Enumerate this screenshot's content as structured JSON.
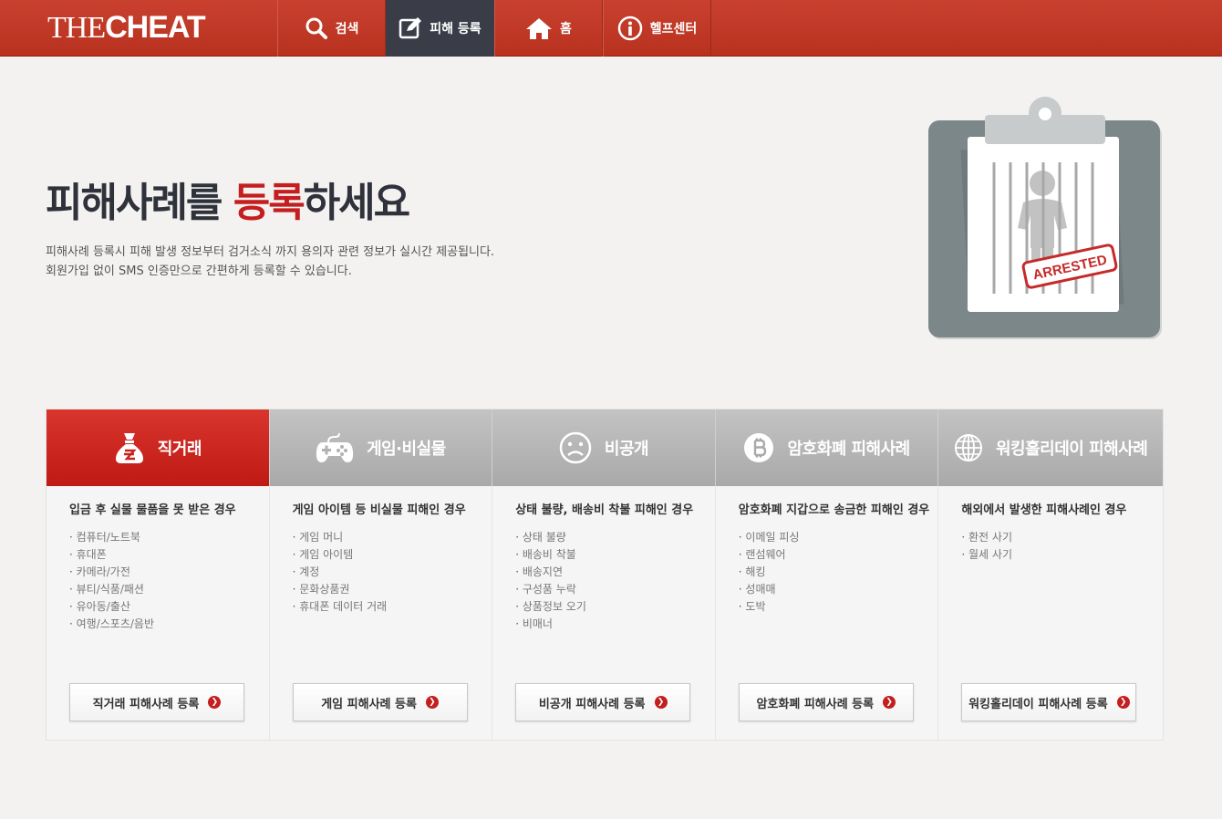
{
  "header": {
    "logo_thin": "THE",
    "logo_bold": "CHEAT",
    "nav": [
      {
        "label": "검색",
        "icon": "search-icon"
      },
      {
        "label": "피해 등록",
        "icon": "edit-icon",
        "active": true
      },
      {
        "label": "홈",
        "icon": "home-icon"
      },
      {
        "label": "헬프센터",
        "icon": "info-icon"
      }
    ]
  },
  "hero": {
    "title_pre": "피해사례를 ",
    "title_accent": "등록",
    "title_post": "하세요",
    "desc_line1": "피해사례 등록시 피해 발생 정보부터 검거소식 까지 용의자 관련 정보가 실시간 제공됩니다.",
    "desc_line2": "회원가입 없이 SMS 인증만으로 간편하게 등록할 수 있습니다.",
    "stamp": "ARRESTED"
  },
  "categories": [
    {
      "tab": "직거래",
      "icon": "money-bag-icon",
      "title": "입금 후 실물 물품을 못 받은 경우",
      "items": [
        "컴퓨터/노트북",
        "휴대폰",
        "카메라/가전",
        "뷰티/식품/패션",
        "유아동/출산",
        "여행/스포츠/음반"
      ],
      "button": "직거래 피해사례 등록"
    },
    {
      "tab": "게임·비실물",
      "icon": "gamepad-icon",
      "title": "게임 아이템 등 비실물 피해인 경우",
      "items": [
        "게임 머니",
        "게임 아이템",
        "계정",
        "문화상품권",
        "휴대폰 데이터 거래"
      ],
      "button": "게임 피해사례 등록"
    },
    {
      "tab": "비공개",
      "icon": "sad-face-icon",
      "title": "상태 불량, 배송비 착불 피해인 경우",
      "items": [
        "상태 불량",
        "배송비 착불",
        "배송지연",
        "구성품 누락",
        "상품정보 오기",
        "비매너"
      ],
      "button": "비공개 피해사례 등록"
    },
    {
      "tab": "암호화폐 피해사례",
      "icon": "bitcoin-icon",
      "title": "암호화폐 지갑으로 송금한 피해인 경우",
      "items": [
        "이메일 피싱",
        "랜섬웨어",
        "해킹",
        "성매매",
        "도박"
      ],
      "button": "암호화폐 피해사례 등록"
    },
    {
      "tab": "워킹홀리데이 피해사례",
      "icon": "globe-icon",
      "title": "해외에서 발생한 피해사례인 경우",
      "items": [
        "환전 사기",
        "월세 사기"
      ],
      "button": "워킹홀리데이 피해사례 등록"
    }
  ],
  "colors": {
    "brand_red": "#c41e1e",
    "header_red": "#c23a28",
    "nav_active": "#3a3d47",
    "tab_inactive": "#b4b4b4"
  }
}
